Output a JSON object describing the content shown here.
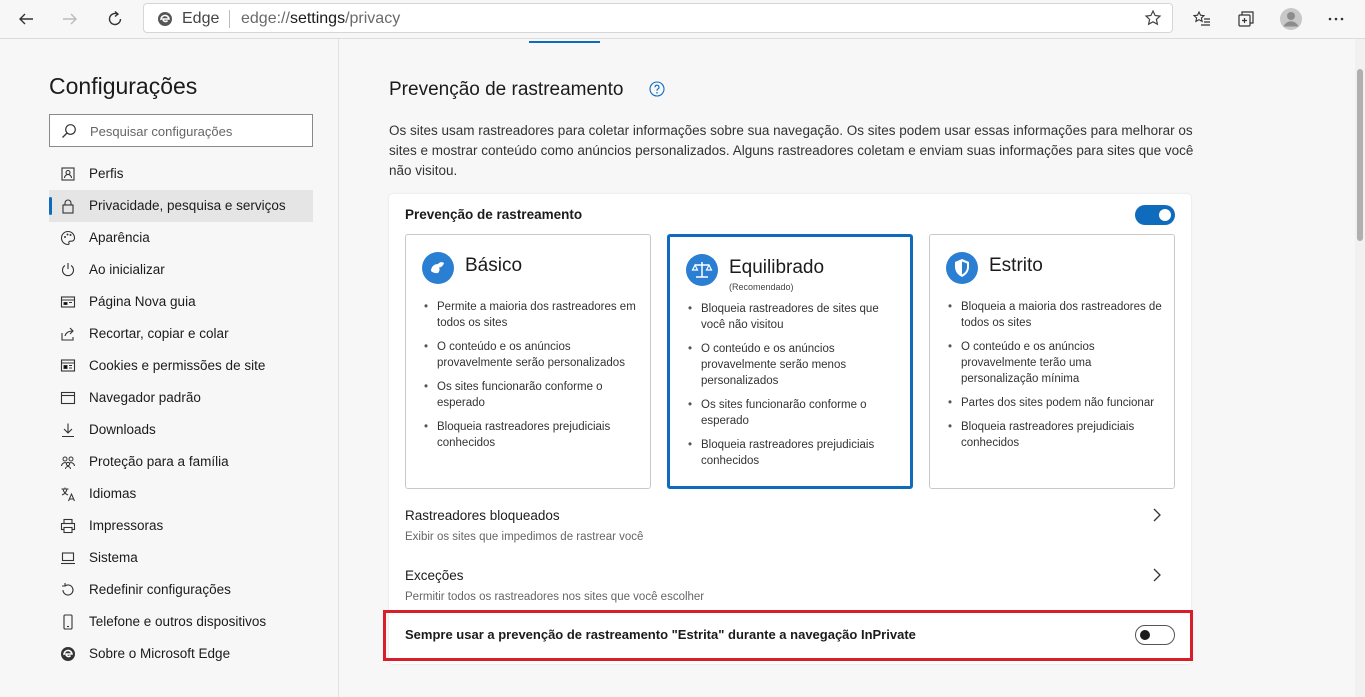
{
  "browser": {
    "brand": "Edge",
    "url_scheme": "edge://",
    "url_host": "settings",
    "url_path": "/privacy"
  },
  "sidebar": {
    "title": "Configurações",
    "search_placeholder": "Pesquisar configurações",
    "items": [
      {
        "label": "Perfis",
        "icon": "profile-icon"
      },
      {
        "label": "Privacidade, pesquisa e serviços",
        "icon": "lock-icon"
      },
      {
        "label": "Aparência",
        "icon": "palette-icon"
      },
      {
        "label": "Ao inicializar",
        "icon": "power-icon"
      },
      {
        "label": "Página Nova guia",
        "icon": "new-tab-icon"
      },
      {
        "label": "Recortar, copiar e colar",
        "icon": "share-icon"
      },
      {
        "label": "Cookies e permissões de site",
        "icon": "cookies-icon"
      },
      {
        "label": "Navegador padrão",
        "icon": "browser-icon"
      },
      {
        "label": "Downloads",
        "icon": "download-icon"
      },
      {
        "label": "Proteção para a família",
        "icon": "family-icon"
      },
      {
        "label": "Idiomas",
        "icon": "language-icon"
      },
      {
        "label": "Impressoras",
        "icon": "printer-icon"
      },
      {
        "label": "Sistema",
        "icon": "system-icon"
      },
      {
        "label": "Redefinir configurações",
        "icon": "reset-icon"
      },
      {
        "label": "Telefone e outros dispositivos",
        "icon": "phone-icon"
      },
      {
        "label": "Sobre o Microsoft Edge",
        "icon": "edge-icon"
      }
    ],
    "active_index": 1
  },
  "main": {
    "heading": "Prevenção de rastreamento",
    "description": "Os sites usam rastreadores para coletar informações sobre sua navegação. Os sites podem usar essas informações para melhorar os sites e mostrar conteúdo como anúncios personalizados. Alguns rastreadores coletam e enviam suas informações para sites que você não visitou.",
    "card_title": "Prevenção de rastreamento",
    "card_toggle_on": true,
    "options": [
      {
        "name": "Básico",
        "subtitle": "",
        "selected": false,
        "icon": "basic-icon",
        "bullets": [
          "Permite a maioria dos rastreadores em todos os sites",
          "O conteúdo e os anúncios provavelmente serão personalizados",
          "Os sites funcionarão conforme o esperado",
          "Bloqueia rastreadores prejudiciais conhecidos"
        ]
      },
      {
        "name": "Equilibrado",
        "subtitle": "(Recomendado)",
        "selected": true,
        "icon": "balance-scale-icon",
        "bullets": [
          "Bloqueia rastreadores de sites que você não visitou",
          "O conteúdo e os anúncios provavelmente serão menos personalizados",
          "Os sites funcionarão conforme o esperado",
          "Bloqueia rastreadores prejudiciais conhecidos"
        ]
      },
      {
        "name": "Estrito",
        "subtitle": "",
        "selected": false,
        "icon": "shield-icon",
        "bullets": [
          "Bloqueia a maioria dos rastreadores de todos os sites",
          "O conteúdo e os anúncios provavelmente terão uma personalização mínima",
          "Partes dos sites podem não funcionar",
          "Bloqueia rastreadores prejudiciais conhecidos"
        ]
      }
    ],
    "blocked_title": "Rastreadores bloqueados",
    "blocked_sub": "Exibir os sites que impedimos de rastrear você",
    "exceptions_title": "Exceções",
    "exceptions_sub": "Permitir todos os rastreadores nos sites que você escolher",
    "inprivate_label": "Sempre usar a prevenção de rastreamento \"Estrita\" durante a navegação InPrivate",
    "inprivate_toggle_on": false,
    "highlight_color": "#d81d2b",
    "accent_color": "#0f6cbd"
  }
}
